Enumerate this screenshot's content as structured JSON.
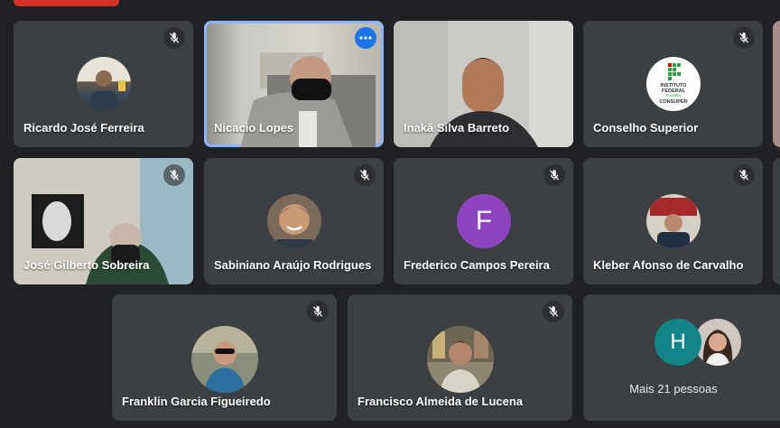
{
  "colors": {
    "background": "#202124",
    "tile": "#3c4043",
    "speaker_outline": "#8ab4f8",
    "menu_button": "#1a73e8",
    "letter_avatar_f": "#8e44c1",
    "letter_avatar_h": "#12858b"
  },
  "participants": [
    {
      "name": "Ricardo José Ferreira",
      "muted": true
    },
    {
      "name": "Nicacio Lopes",
      "muted": false,
      "speaking": true
    },
    {
      "name": "Inakã Silva Barreto",
      "muted": false
    },
    {
      "name": "Conselho Superior",
      "muted": true,
      "logo_text": [
        "INSTITUTO",
        "FEDERAL",
        "Paraíba",
        "CONSUPER"
      ]
    },
    {
      "name": "José Gilberto Sobreira",
      "muted": true
    },
    {
      "name": "Sabiniano Araújo Rodrigues",
      "muted": true
    },
    {
      "name": "Frederico Campos Pereira",
      "muted": true,
      "avatar_letter": "F"
    },
    {
      "name": "Kleber Afonso de Carvalho",
      "muted": true
    },
    {
      "name": "Franklin Garcia Figueiredo",
      "muted": true
    },
    {
      "name": "Francisco Almeida de Lucena",
      "muted": true
    }
  ],
  "overflow": {
    "label": "Mais 21 pessoas",
    "avatar_letter": "H"
  },
  "icons": {
    "mic": "mic-off-icon",
    "menu": "more-options-icon"
  }
}
